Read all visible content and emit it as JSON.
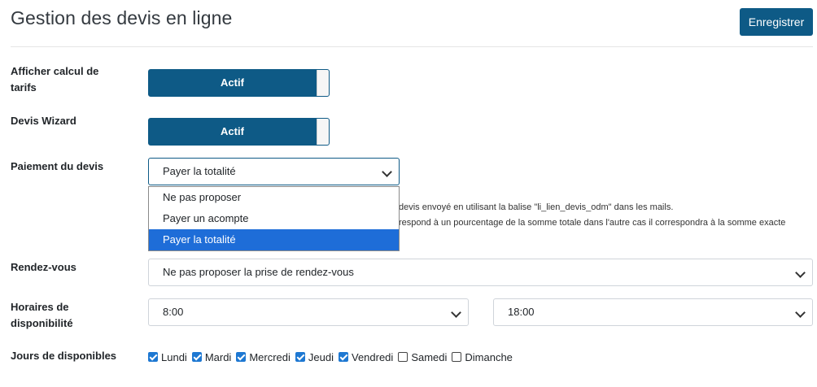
{
  "header": {
    "title": "Gestion des devis en ligne",
    "save_label": "Enregistrer"
  },
  "fields": {
    "calcul_tarifs": {
      "label": "Afficher calcul de tarifs",
      "value": "Actif"
    },
    "devis_wizard": {
      "label": "Devis Wizard",
      "value": "Actif"
    },
    "paiement": {
      "label": "Paiement du devis",
      "selected": "Payer la totalité",
      "options": [
        "Ne pas proposer",
        "Payer un acompte",
        "Payer la totalité"
      ],
      "help_line1": "devis envoyé en utilisant la balise \"li_lien_devis_odm\" dans les mails.",
      "help_line2": "respond à un pourcentage de la somme totale dans l'autre cas il correspondra à la somme exacte"
    },
    "rendez_vous": {
      "label": "Rendez-vous",
      "selected": "Ne pas proposer la prise de rendez-vous"
    },
    "horaires": {
      "label": "Horaires de disponibilité",
      "start": "8:00",
      "end": "18:00"
    },
    "jours": {
      "label": "Jours de disponibles",
      "days": [
        {
          "name": "Lundi",
          "checked": true
        },
        {
          "name": "Mardi",
          "checked": true
        },
        {
          "name": "Mercredi",
          "checked": true
        },
        {
          "name": "Jeudi",
          "checked": true
        },
        {
          "name": "Vendredi",
          "checked": true
        },
        {
          "name": "Samedi",
          "checked": false
        },
        {
          "name": "Dimanche",
          "checked": false
        }
      ]
    }
  },
  "colors": {
    "primary": "#0e5a86",
    "selected_option": "#1e6dd8",
    "checkbox": "#1e78d2"
  }
}
